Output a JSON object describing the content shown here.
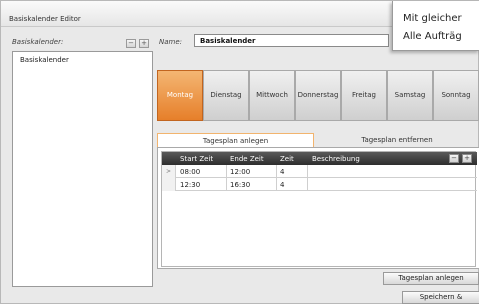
{
  "window": {
    "title": "Basiskalender Editor"
  },
  "tooltip": {
    "line1": "Mit gleicher",
    "line2": "Alle Aufträg"
  },
  "left": {
    "label": "Basiskalender:",
    "items": [
      "Basiskalender"
    ],
    "btn_minus": "−",
    "btn_plus": "+"
  },
  "name": {
    "label": "Name:",
    "value": "Basiskalender"
  },
  "days": [
    "Montag",
    "Dienstag",
    "Mittwoch",
    "Donnerstag",
    "Freitag",
    "Samstag",
    "Sonntag"
  ],
  "active_day": "Montag",
  "colors": {
    "active_day": "#e67f2a",
    "grid_header": "#2d2d2d",
    "tab_accent": "#f2b46e"
  },
  "tabs": {
    "add": "Tagesplan anlegen",
    "remove": "Tagesplan entfernen"
  },
  "grid": {
    "headers": [
      "Start Zeit",
      "Ende Zeit",
      "Zeit",
      "Beschreibung"
    ],
    "rows": [
      {
        "indicator": ">",
        "start": "08:00",
        "end": "12:00",
        "time": "4",
        "desc": ""
      },
      {
        "indicator": "",
        "start": "12:30",
        "end": "16:30",
        "time": "4",
        "desc": ""
      }
    ],
    "btn_minus": "−",
    "btn_plus": "+"
  },
  "buttons": {
    "add_plan": "Tagesplan anlegen",
    "save_close": "Speichern & Schliessen"
  }
}
